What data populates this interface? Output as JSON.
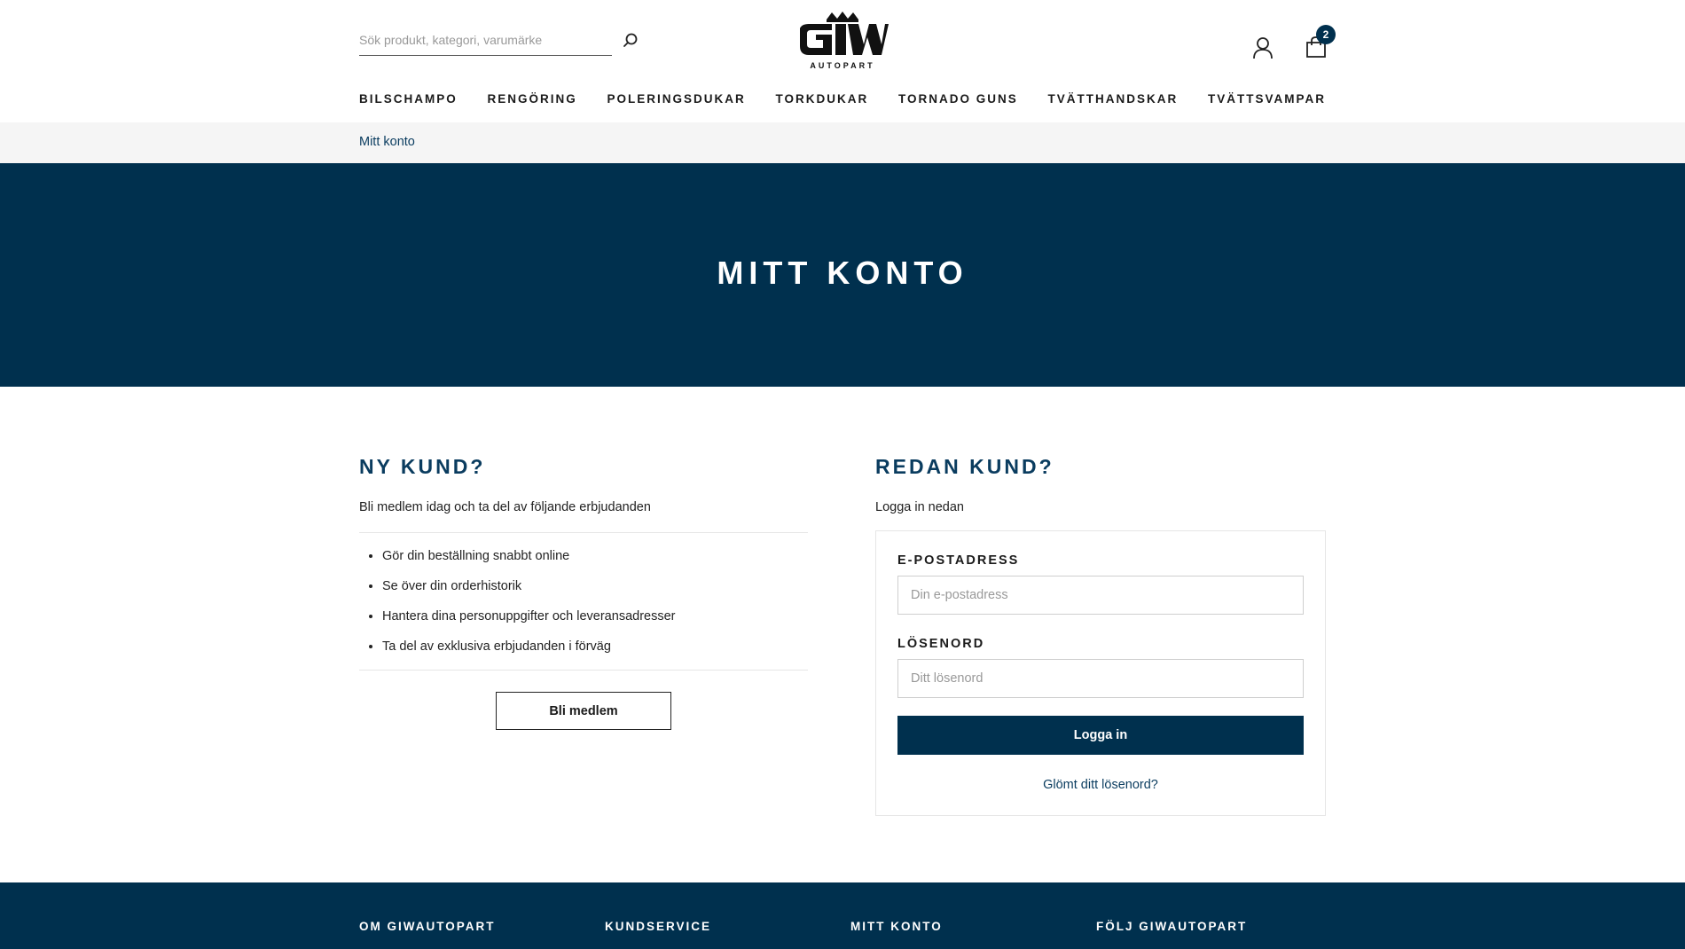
{
  "header": {
    "search_placeholder": "Sök produkt, kategori, varumärke",
    "logo_text": "AUTOPART",
    "cart_count": "2"
  },
  "nav": {
    "items": [
      "BILSCHAMPO",
      "RENGÖRING",
      "POLERINGSDUKAR",
      "TORKDUKAR",
      "TORNADO GUNS",
      "TVÄTTHANDSKAR",
      "TVÄTTSVAMPAR"
    ]
  },
  "breadcrumb": {
    "current": "Mitt konto"
  },
  "hero": {
    "title": "MITT KONTO"
  },
  "new_customer": {
    "title": "NY KUND?",
    "subtitle": "Bli medlem idag och ta del av följande erbjudanden",
    "benefits": [
      "Gör din beställning snabbt online",
      "Se över din orderhistorik",
      "Hantera dina personuppgifter och leveransadresser",
      "Ta del av exklusiva erbjudanden i förväg"
    ],
    "button_label": "Bli medlem"
  },
  "existing_customer": {
    "title": "REDAN KUND?",
    "subtitle": "Logga in nedan",
    "email_label": "E-POSTADRESS",
    "email_placeholder": "Din e-postadress",
    "password_label": "LÖSENORD",
    "password_placeholder": "Ditt lösenord",
    "login_label": "Logga in",
    "forgot_label": "Glömt ditt lösenord?"
  },
  "footer": {
    "columns": [
      "OM GIWAUTOPART",
      "KUNDSERVICE",
      "MITT KONTO",
      "FÖLJ GIWAUTOPART"
    ]
  },
  "colors": {
    "primary": "#00304e",
    "link": "#0a3c5f",
    "breadcrumb_bg": "#f5f5f5"
  },
  "icons": [
    "search-icon",
    "user-icon",
    "shopping-bag-icon",
    "logo-crown"
  ]
}
